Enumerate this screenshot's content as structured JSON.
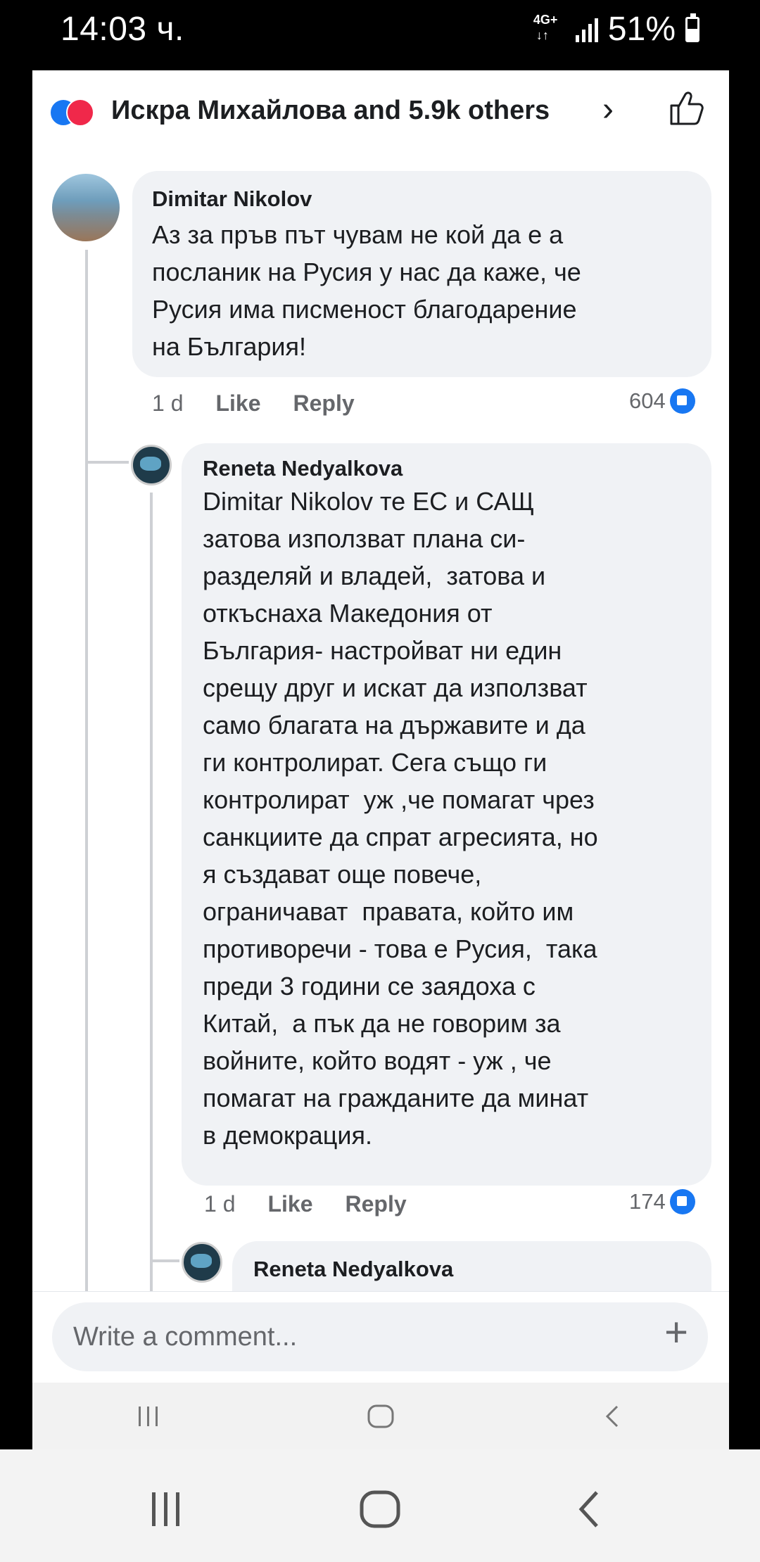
{
  "status_bar": {
    "time": "14:03 ч.",
    "network": "4G+",
    "battery_percent": "51%",
    "battery_level": 0.51
  },
  "header": {
    "reactions_summary": "Искра Михайлова and 5.9k others",
    "reaction_icons": [
      "like-icon",
      "love-icon"
    ]
  },
  "comments": [
    {
      "author": "Dimitar Nikolov",
      "text": "Аз за пръв път чувам не кой да е а\nпосланик на Русия у нас да каже, че\nРусия има писменост благодарение\nна България!",
      "age": "1 d",
      "like_label": "Like",
      "reply_label": "Reply",
      "reaction_count": "604"
    },
    {
      "author": "Reneta Nedyalkova",
      "text": "Dimitar Nikolov те ЕС и САЩ\nзатова използват плана си-\nразделяй и владей,  затова и\nоткъснаха Македония от\nБългария- настройват ни един\nсрещу друг и искат да използват\nсамо благата на държавите и да\nги контролират. Сега също ги\nконтролират  уж ,че помагат чрез\nсанкциите да спрат агресията, но\nя създават още повече,\nограничават  правата, който им\nпротиворечи - това е Русия,  така\nпреди 3 години се заядоха с\nКитай,  а пък да не говорим за\nвойните, който водят - уж , че\nпомагат на гражданите да минат\nв демокрация.",
      "age": "1 d",
      "like_label": "Like",
      "reply_label": "Reply",
      "reaction_count": "174"
    },
    {
      "author": "Reneta Nedyalkova"
    }
  ],
  "composer": {
    "placeholder": "Write a comment..."
  },
  "colors": {
    "facebook_blue": "#1877f2",
    "love_red": "#f0284a",
    "bubble_bg": "#f0f2f5",
    "meta_gray": "#65676b"
  }
}
